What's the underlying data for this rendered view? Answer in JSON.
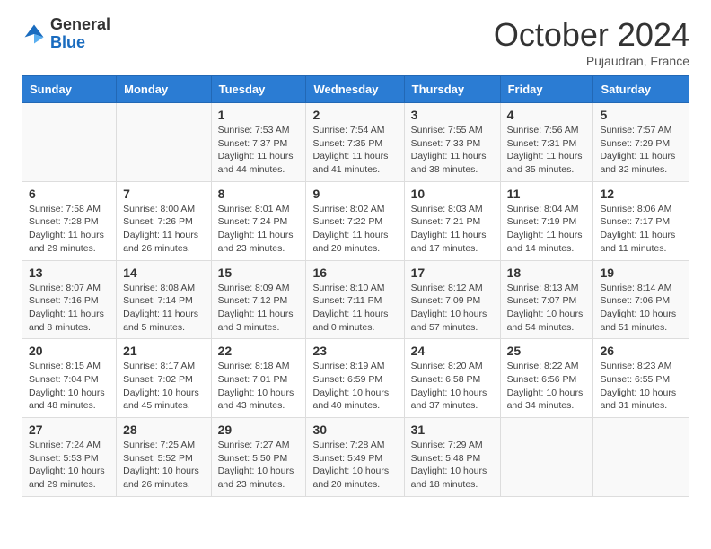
{
  "header": {
    "logo_general": "General",
    "logo_blue": "Blue",
    "month_title": "October 2024",
    "subtitle": "Pujaudran, France"
  },
  "days_of_week": [
    "Sunday",
    "Monday",
    "Tuesday",
    "Wednesday",
    "Thursday",
    "Friday",
    "Saturday"
  ],
  "weeks": [
    [
      {
        "day": "",
        "info": ""
      },
      {
        "day": "",
        "info": ""
      },
      {
        "day": "1",
        "info": "Sunrise: 7:53 AM\nSunset: 7:37 PM\nDaylight: 11 hours and 44 minutes."
      },
      {
        "day": "2",
        "info": "Sunrise: 7:54 AM\nSunset: 7:35 PM\nDaylight: 11 hours and 41 minutes."
      },
      {
        "day": "3",
        "info": "Sunrise: 7:55 AM\nSunset: 7:33 PM\nDaylight: 11 hours and 38 minutes."
      },
      {
        "day": "4",
        "info": "Sunrise: 7:56 AM\nSunset: 7:31 PM\nDaylight: 11 hours and 35 minutes."
      },
      {
        "day": "5",
        "info": "Sunrise: 7:57 AM\nSunset: 7:29 PM\nDaylight: 11 hours and 32 minutes."
      }
    ],
    [
      {
        "day": "6",
        "info": "Sunrise: 7:58 AM\nSunset: 7:28 PM\nDaylight: 11 hours and 29 minutes."
      },
      {
        "day": "7",
        "info": "Sunrise: 8:00 AM\nSunset: 7:26 PM\nDaylight: 11 hours and 26 minutes."
      },
      {
        "day": "8",
        "info": "Sunrise: 8:01 AM\nSunset: 7:24 PM\nDaylight: 11 hours and 23 minutes."
      },
      {
        "day": "9",
        "info": "Sunrise: 8:02 AM\nSunset: 7:22 PM\nDaylight: 11 hours and 20 minutes."
      },
      {
        "day": "10",
        "info": "Sunrise: 8:03 AM\nSunset: 7:21 PM\nDaylight: 11 hours and 17 minutes."
      },
      {
        "day": "11",
        "info": "Sunrise: 8:04 AM\nSunset: 7:19 PM\nDaylight: 11 hours and 14 minutes."
      },
      {
        "day": "12",
        "info": "Sunrise: 8:06 AM\nSunset: 7:17 PM\nDaylight: 11 hours and 11 minutes."
      }
    ],
    [
      {
        "day": "13",
        "info": "Sunrise: 8:07 AM\nSunset: 7:16 PM\nDaylight: 11 hours and 8 minutes."
      },
      {
        "day": "14",
        "info": "Sunrise: 8:08 AM\nSunset: 7:14 PM\nDaylight: 11 hours and 5 minutes."
      },
      {
        "day": "15",
        "info": "Sunrise: 8:09 AM\nSunset: 7:12 PM\nDaylight: 11 hours and 3 minutes."
      },
      {
        "day": "16",
        "info": "Sunrise: 8:10 AM\nSunset: 7:11 PM\nDaylight: 11 hours and 0 minutes."
      },
      {
        "day": "17",
        "info": "Sunrise: 8:12 AM\nSunset: 7:09 PM\nDaylight: 10 hours and 57 minutes."
      },
      {
        "day": "18",
        "info": "Sunrise: 8:13 AM\nSunset: 7:07 PM\nDaylight: 10 hours and 54 minutes."
      },
      {
        "day": "19",
        "info": "Sunrise: 8:14 AM\nSunset: 7:06 PM\nDaylight: 10 hours and 51 minutes."
      }
    ],
    [
      {
        "day": "20",
        "info": "Sunrise: 8:15 AM\nSunset: 7:04 PM\nDaylight: 10 hours and 48 minutes."
      },
      {
        "day": "21",
        "info": "Sunrise: 8:17 AM\nSunset: 7:02 PM\nDaylight: 10 hours and 45 minutes."
      },
      {
        "day": "22",
        "info": "Sunrise: 8:18 AM\nSunset: 7:01 PM\nDaylight: 10 hours and 43 minutes."
      },
      {
        "day": "23",
        "info": "Sunrise: 8:19 AM\nSunset: 6:59 PM\nDaylight: 10 hours and 40 minutes."
      },
      {
        "day": "24",
        "info": "Sunrise: 8:20 AM\nSunset: 6:58 PM\nDaylight: 10 hours and 37 minutes."
      },
      {
        "day": "25",
        "info": "Sunrise: 8:22 AM\nSunset: 6:56 PM\nDaylight: 10 hours and 34 minutes."
      },
      {
        "day": "26",
        "info": "Sunrise: 8:23 AM\nSunset: 6:55 PM\nDaylight: 10 hours and 31 minutes."
      }
    ],
    [
      {
        "day": "27",
        "info": "Sunrise: 7:24 AM\nSunset: 5:53 PM\nDaylight: 10 hours and 29 minutes."
      },
      {
        "day": "28",
        "info": "Sunrise: 7:25 AM\nSunset: 5:52 PM\nDaylight: 10 hours and 26 minutes."
      },
      {
        "day": "29",
        "info": "Sunrise: 7:27 AM\nSunset: 5:50 PM\nDaylight: 10 hours and 23 minutes."
      },
      {
        "day": "30",
        "info": "Sunrise: 7:28 AM\nSunset: 5:49 PM\nDaylight: 10 hours and 20 minutes."
      },
      {
        "day": "31",
        "info": "Sunrise: 7:29 AM\nSunset: 5:48 PM\nDaylight: 10 hours and 18 minutes."
      },
      {
        "day": "",
        "info": ""
      },
      {
        "day": "",
        "info": ""
      }
    ]
  ]
}
